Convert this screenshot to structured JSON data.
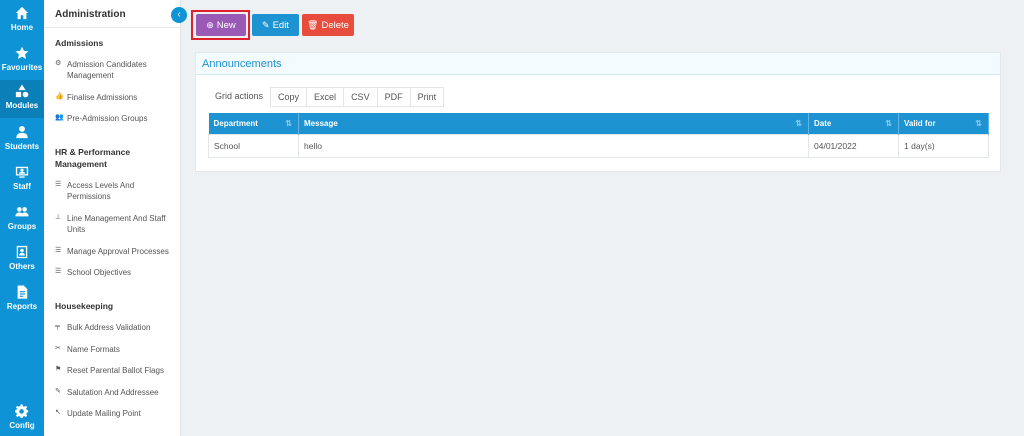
{
  "rail": {
    "items": [
      {
        "label": "Home",
        "icon": "home-icon"
      },
      {
        "label": "Favourites",
        "icon": "star-icon"
      },
      {
        "label": "Modules",
        "icon": "modules-icon"
      },
      {
        "label": "Students",
        "icon": "student-icon"
      },
      {
        "label": "Staff",
        "icon": "staff-icon"
      },
      {
        "label": "Groups",
        "icon": "groups-icon"
      },
      {
        "label": "Others",
        "icon": "others-icon"
      },
      {
        "label": "Reports",
        "icon": "reports-icon"
      },
      {
        "label": "Config",
        "icon": "gear-icon"
      }
    ]
  },
  "sidebar": {
    "title": "Administration",
    "sections": [
      {
        "heading": "Admissions",
        "items": [
          "Admission Candidates Management",
          "Finalise Admissions",
          "Pre-Admission Groups"
        ]
      },
      {
        "heading": "HR & Performance Management",
        "items": [
          "Access Levels And Permissions",
          "Line Management And Staff Units",
          "Manage Approval Processes",
          "School Objectives"
        ]
      },
      {
        "heading": "Housekeeping",
        "items": [
          "Bulk Address Validation",
          "Name Formats",
          "Reset Parental Ballot Flags",
          "Salutation And Addressee",
          "Update Mailing Point"
        ]
      }
    ]
  },
  "toolbar": {
    "new_label": "New",
    "edit_label": "Edit",
    "delete_label": "Delete"
  },
  "panel": {
    "title": "Announcements",
    "grid_actions_label": "Grid actions",
    "grid_actions": [
      "Copy",
      "Excel",
      "CSV",
      "PDF",
      "Print"
    ]
  },
  "table": {
    "columns": [
      "Department",
      "Message",
      "Date",
      "Valid for"
    ],
    "rows": [
      [
        "School",
        "hello",
        "04/01/2022",
        "1 day(s)"
      ]
    ]
  },
  "colors": {
    "rail": "#0e94d6",
    "new": "#9b59b6",
    "edit": "#1d93d2",
    "delete": "#e74c3c",
    "highlight": "#e0202a"
  }
}
